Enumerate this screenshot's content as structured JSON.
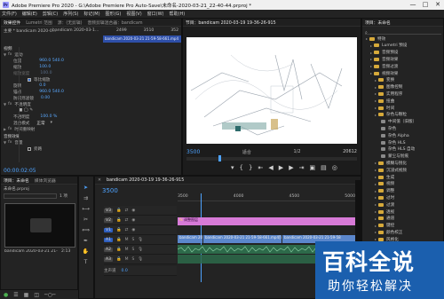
{
  "window": {
    "title": "Adobe Premiere Pro 2020 - G:\\Adobe Premiere Pro Auto-Save\\未命名-2020-03-21_22-40-44.prproj *",
    "controls": [
      "—",
      "□",
      "✕"
    ]
  },
  "menubar": [
    "文件(F)",
    "编辑(E)",
    "剪辑(C)",
    "序列(S)",
    "标记(M)",
    "图形(G)",
    "视图(V)",
    "窗口(W)",
    "帮助(H)"
  ],
  "effect_controls": {
    "tabs": [
      "效果控件",
      "Lumetri 范围",
      "源：(无剪辑)",
      "音频剪辑混合器：bandicam"
    ],
    "header_left": "主要 * bandicam 2020-0...",
    "header_right": "bandicam 2020-03-1...",
    "ruler": [
      "2499",
      "3510",
      "352"
    ],
    "clip_label": "bandicam 2020-03-21 21-59-58-661.mp4",
    "section_video": "视频",
    "rows": [
      {
        "label": "运动",
        "value": ""
      },
      {
        "label": "位置",
        "value": "960.0   540.0"
      },
      {
        "label": "缩放",
        "value": "100.0"
      },
      {
        "label": "缩放宽度",
        "value": "100.0"
      },
      {
        "label": "",
        "value": "等比缩放"
      },
      {
        "label": "旋转",
        "value": "0.0"
      },
      {
        "label": "锚点",
        "value": "960.0   540.0"
      },
      {
        "label": "防闪烁滤镜",
        "value": "0.00"
      },
      {
        "label": "不透明度",
        "value": ""
      },
      {
        "label": "",
        "value": "■ ◯ ✎"
      },
      {
        "label": "不透明度",
        "value": "100.0 %"
      },
      {
        "label": "混合模式",
        "value": "正常"
      },
      {
        "label": "时间重映射",
        "value": ""
      },
      {
        "label": "音频效果",
        "value": ""
      },
      {
        "label": "音量",
        "value": ""
      },
      {
        "label": "",
        "value": "旁路"
      }
    ],
    "timecode": "00:00:02:05"
  },
  "program_monitor": {
    "tab": "节目：bandicam 2020-03-19 19-36-26-915",
    "timecode_left": "3500",
    "fit": "适合",
    "fraction": "1/2",
    "timecode_right": "20612"
  },
  "project_panel": {
    "tab": "项目：未命名",
    "items": [
      {
        "name": "特效",
        "level": 0
      },
      {
        "name": "Lumetri 预设",
        "level": 1
      },
      {
        "name": "音频预设",
        "level": 1
      },
      {
        "name": "音频效果",
        "level": 1
      },
      {
        "name": "音频过渡",
        "level": 1
      },
      {
        "name": "视频效果",
        "level": 1
      },
      {
        "name": "变换",
        "level": 2
      },
      {
        "name": "图像控制",
        "level": 2
      },
      {
        "name": "实用程序",
        "level": 2
      },
      {
        "name": "扭曲",
        "level": 2
      },
      {
        "name": "时间",
        "level": 2
      },
      {
        "name": "杂色与颗粒",
        "level": 2
      },
      {
        "name": "中间值（旧版）",
        "level": 3
      },
      {
        "name": "杂色",
        "level": 3
      },
      {
        "name": "杂色 Alpha",
        "level": 3
      },
      {
        "name": "杂色 HLS",
        "level": 3
      },
      {
        "name": "杂色 HLS 自动",
        "level": 3
      },
      {
        "name": "蒙尘与划痕",
        "level": 3
      },
      {
        "name": "模糊与锐化",
        "level": 2
      },
      {
        "name": "沉浸式视频",
        "level": 2
      },
      {
        "name": "生成",
        "level": 2
      },
      {
        "name": "视频",
        "level": 2
      },
      {
        "name": "调整",
        "level": 2
      },
      {
        "name": "过时",
        "level": 2
      },
      {
        "name": "过渡",
        "level": 2
      },
      {
        "name": "透视",
        "level": 2
      },
      {
        "name": "通道",
        "level": 2
      },
      {
        "name": "键控",
        "level": 2
      },
      {
        "name": "颜色校正",
        "level": 2
      },
      {
        "name": "风格化",
        "level": 2
      }
    ]
  },
  "project_bin": {
    "tabs": [
      "项目：未命名",
      "媒体浏览器"
    ],
    "file": "未命名.prproj",
    "search_placeholder": "",
    "count": "1 项",
    "clip_name": "bandicam 2020-03-21 21-59-58-661",
    "clip_duration": "2:13"
  },
  "timeline": {
    "tab": "bandicam 2020-03-19 19-36-26-915",
    "timecode": "3500",
    "ruler": [
      "3500",
      "4000",
      "4500",
      "5000"
    ],
    "tracks": [
      {
        "name": "V3"
      },
      {
        "name": "V2"
      },
      {
        "name": "V1"
      },
      {
        "name": "A1"
      },
      {
        "name": "A2"
      },
      {
        "name": "A3"
      }
    ],
    "track_buttons": [
      "M",
      "S"
    ],
    "master": "主声道",
    "master_value": "0.0",
    "title_clip": "调整图层",
    "v1_clips": [
      "bandicam 2020-03-21 21-59-58-661.mp4[V]",
      "bandicam 2020-03-21 21-59-58-661.mp4[V]",
      "bandicam 2020-03-21 21-59-58"
    ]
  },
  "watermark": {
    "big": "百科全说",
    "small": "助你轻松解决"
  },
  "colors": {
    "accent_blue": "#4ea3ff",
    "clip_pink": "#d77ad7",
    "clip_blue": "#5b87cc",
    "audio_green": "#3f8d5d",
    "watermark_blue": "#1b5fae"
  }
}
